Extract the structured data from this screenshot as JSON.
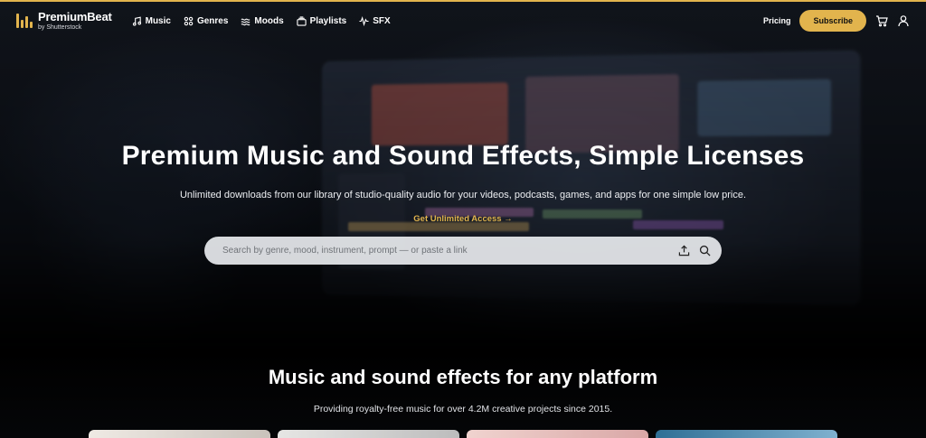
{
  "brand": {
    "name": "PremiumBeat",
    "sub": "by Shutterstock",
    "accent_color": "#e2b44d"
  },
  "nav": {
    "items": [
      {
        "label": "Music",
        "icon": "music-note-icon"
      },
      {
        "label": "Genres",
        "icon": "grid-icon"
      },
      {
        "label": "Moods",
        "icon": "waves-icon"
      },
      {
        "label": "Playlists",
        "icon": "playlist-icon"
      },
      {
        "label": "SFX",
        "icon": "waveform-icon"
      }
    ],
    "pricing": "Pricing",
    "subscribe": "Subscribe",
    "cart_icon": "cart-icon",
    "account_icon": "user-icon"
  },
  "hero": {
    "title": "Premium Music and Sound Effects, Simple Licenses",
    "subtitle": "Unlimited downloads from our library of studio-quality audio for your videos, podcasts, games, and apps for one simple low price.",
    "cta": "Get Unlimited Access →"
  },
  "search": {
    "placeholder": "Search by genre, mood, instrument, prompt — or paste a link",
    "value": "",
    "upload_icon": "upload-icon",
    "search_icon": "search-icon"
  },
  "section": {
    "title": "Music and sound effects for any platform",
    "subtitle": "Providing royalty-free music for over 4.2M creative projects since 2015."
  },
  "cards": [
    {
      "color": "#c9c2bb"
    },
    {
      "color": "#d8d8d6"
    },
    {
      "color": "#d9a7a6"
    },
    {
      "color": "#4e86a8"
    }
  ]
}
